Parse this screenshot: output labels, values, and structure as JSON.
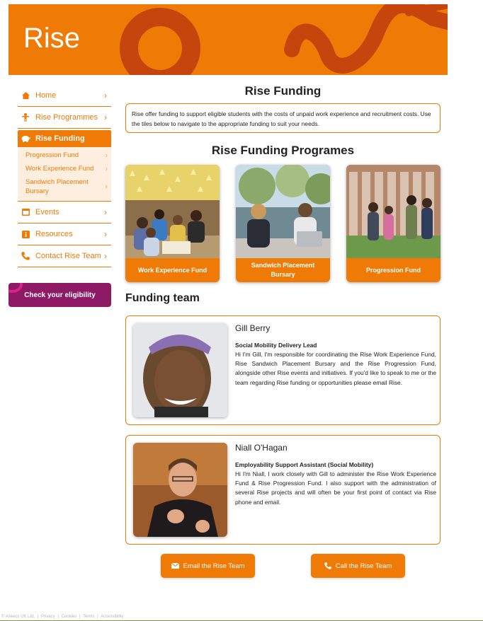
{
  "banner": {
    "title": "Rise"
  },
  "sidebar": {
    "items": [
      {
        "label": "Home",
        "icon": "home-icon"
      },
      {
        "label": "Rise Programmes",
        "icon": "person-icon"
      },
      {
        "label": "Rise Funding",
        "icon": "piggy-bank-icon"
      },
      {
        "label": "Events",
        "icon": "calendar-icon"
      },
      {
        "label": "Resources",
        "icon": "info-icon"
      },
      {
        "label": "Contact Rise Team",
        "icon": "phone-icon"
      }
    ],
    "subitems": [
      {
        "label": "Progression Fund"
      },
      {
        "label": "Work Experience Fund"
      },
      {
        "label": "Sandwich Placement Bursary"
      }
    ],
    "eligibility_button": "Check your eligibility"
  },
  "main": {
    "title": "Rise Funding",
    "intro": "Rise offer funding to support eligible students with the costs of unpaid work experience and recruitment costs. Use the tiles below to navigate to the appropriate funding to suit your needs.",
    "programmes_title": "Rise Funding Programes",
    "tiles": [
      {
        "label": "Work Experience Fund"
      },
      {
        "label": "Sandwich Placement Bursary"
      },
      {
        "label": "Progression Fund"
      }
    ],
    "team_title": "Funding team",
    "team": [
      {
        "name": "Gill Berry",
        "role": "Social Mobility Delivery Lead",
        "bio": "Hi I'm Gill, I'm responsible for coordinating the Rise Work Experience Fund, Rise Sandwich Placement Bursary and the Rise Progression Fund, alongside other Rise events and initiatives. If you'd like to speak to me or the team regarding Rise funding or opportunities please email Rise."
      },
      {
        "name": "Niall O'Hagan",
        "role": "Employability Support Assistant (Social Mobility)",
        "bio": "Hi I'm Niall, I work closely with Gill to administer the Rise Work Experience Fund & Rise Progression Fund. I also support with the administration of several Rise projects and will often be your first point of contact via Rise phone and email."
      }
    ],
    "email_button": "Email the Rise Team",
    "call_button": "Call the Rise Team"
  },
  "footer": {
    "links": [
      "© Aseecs UK Ltd.",
      "|",
      "Privacy",
      "|",
      "Cookies",
      "|",
      "Terms",
      "|",
      "Accessibility"
    ]
  },
  "colors": {
    "accent": "#ef7a06",
    "accent_dark": "#c5450c",
    "eligibility": "#8e1a66",
    "sub_bg": "#fdeee0"
  }
}
